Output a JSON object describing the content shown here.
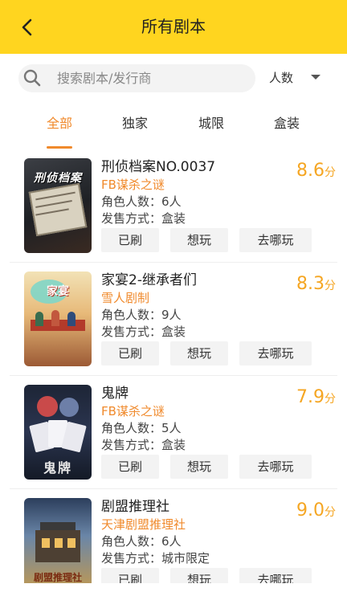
{
  "header": {
    "title": "所有剧本"
  },
  "search": {
    "placeholder": "搜索剧本/发行商",
    "value": ""
  },
  "filter": {
    "label": "人数"
  },
  "tabs": [
    {
      "label": "全部",
      "active": true
    },
    {
      "label": "独家",
      "active": false
    },
    {
      "label": "城限",
      "active": false
    },
    {
      "label": "盒装",
      "active": false
    }
  ],
  "labels": {
    "roles_prefix": "角色人数：",
    "sale_prefix": "发售方式：",
    "score_unit": "分",
    "btn_played": "已刷",
    "btn_want": "想玩",
    "btn_where": "去哪玩"
  },
  "scripts": [
    {
      "title": "刑侦档案NO.0037",
      "publisher": "FB谋杀之谜",
      "roles": "6人",
      "sale": "盒装",
      "score": "8.6",
      "cover_text": "刑侦档案"
    },
    {
      "title": "家宴2-继承者们",
      "publisher": "雪人剧制",
      "roles": "9人",
      "sale": "盒装",
      "score": "8.3",
      "cover_text": "家宴"
    },
    {
      "title": "鬼牌",
      "publisher": "FB谋杀之谜",
      "roles": "5人",
      "sale": "盒装",
      "score": "7.9",
      "cover_text": "鬼牌"
    },
    {
      "title": "剧盟推理社",
      "publisher": "天津剧盟推理社",
      "roles": "6人",
      "sale": "城市限定",
      "score": "9.0",
      "cover_text": "剧盟推理社"
    }
  ],
  "colors": {
    "header_bg": "#ffd51f",
    "accent": "#f08a2c",
    "score": "#f5a623"
  }
}
